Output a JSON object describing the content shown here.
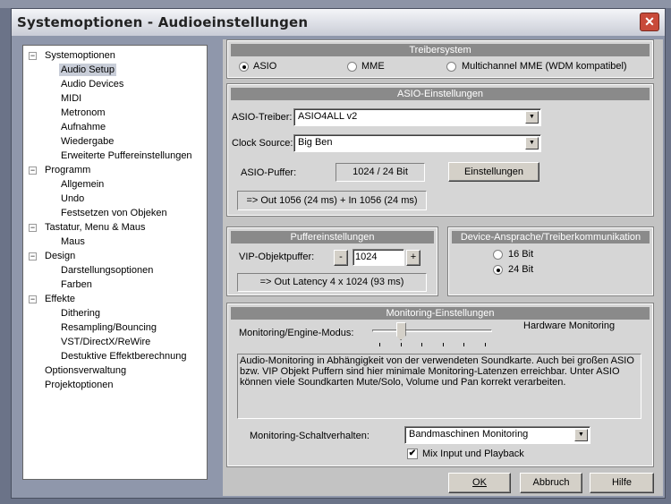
{
  "window": {
    "title": "Systemoptionen - Audioeinstellungen",
    "close": "✕"
  },
  "tree": [
    {
      "label": "Systemoptionen",
      "level": 0,
      "box": "−"
    },
    {
      "label": "Audio Setup",
      "level": 1,
      "selected": true
    },
    {
      "label": "Audio Devices",
      "level": 1
    },
    {
      "label": "MIDI",
      "level": 1
    },
    {
      "label": "Metronom",
      "level": 1
    },
    {
      "label": "Aufnahme",
      "level": 1
    },
    {
      "label": "Wiedergabe",
      "level": 1
    },
    {
      "label": "Erweiterte Puffereinstellungen",
      "level": 1
    },
    {
      "label": "Programm",
      "level": 0,
      "box": "−"
    },
    {
      "label": "Allgemein",
      "level": 1
    },
    {
      "label": "Undo",
      "level": 1
    },
    {
      "label": "Festsetzen von Objeken",
      "level": 1
    },
    {
      "label": "Tastatur, Menu & Maus",
      "level": 0,
      "box": "−"
    },
    {
      "label": "Maus",
      "level": 1
    },
    {
      "label": "Design",
      "level": 0,
      "box": "−"
    },
    {
      "label": "Darstellungsoptionen",
      "level": 1
    },
    {
      "label": "Farben",
      "level": 1
    },
    {
      "label": "Effekte",
      "level": 0,
      "box": "−"
    },
    {
      "label": "Dithering",
      "level": 1
    },
    {
      "label": "Resampling/Bouncing",
      "level": 1
    },
    {
      "label": "VST/DirectX/ReWire",
      "level": 1
    },
    {
      "label": "Destuktive Effektberechnung",
      "level": 1
    },
    {
      "label": "Optionsverwaltung",
      "level": 0
    },
    {
      "label": "Projektoptionen",
      "level": 0
    }
  ],
  "treiber": {
    "title": "Treibersystem",
    "options": [
      "ASIO",
      "MME",
      "Multichannel MME (WDM kompatibel)"
    ],
    "selected": "ASIO"
  },
  "asio": {
    "title": "ASIO-Einstellungen",
    "driver_label": "ASIO-Treiber:",
    "driver_value": "ASIO4ALL v2",
    "clock_label": "Clock Source:",
    "clock_value": "Big Ben",
    "buffer_label": "ASIO-Puffer:",
    "buffer_value": "1024 / 24 Bit",
    "settings_button": "Einstellungen",
    "latency": "=> Out 1056 (24 ms) + In 1056 (24 ms)"
  },
  "puffer": {
    "title": "Puffereinstellungen",
    "label": "VIP-Objektpuffer:",
    "minus": "-",
    "value": "1024",
    "plus": "+",
    "latency": "=> Out Latency 4 x 1024 (93 ms)"
  },
  "device": {
    "title": "Device-Ansprache/Treiberkommunikation",
    "options": [
      "16 Bit",
      "24 Bit"
    ],
    "selected": "24 Bit"
  },
  "monitoring": {
    "title": "Monitoring-Einstellungen",
    "mode_label": "Monitoring/Engine-Modus:",
    "mode_value": "Hardware Monitoring",
    "slider_position": 1,
    "slider_steps": 6,
    "description": "Audio-Monitoring in Abhängigkeit von der verwendeten Soundkarte. Auch bei großen ASIO bzw. VIP Objekt Puffern sind hier minimale Monitoring-Latenzen erreichbar. Unter ASIO können viele Soundkarten Mute/Solo,  Volume und Pan korrekt verarbeiten.",
    "switch_label": "Monitoring-Schaltverhalten:",
    "switch_value": "Bandmaschinen Monitoring",
    "mix_label": "Mix Input und Playback",
    "mix_checked": true
  },
  "buttons": {
    "ok": "OK",
    "cancel": "Abbruch",
    "help": "Hilfe"
  }
}
